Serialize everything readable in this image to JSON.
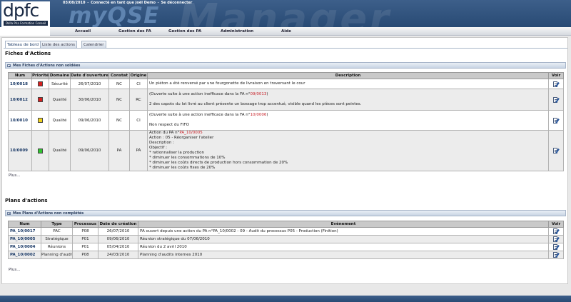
{
  "header": {
    "logo_text": "dpfc",
    "logo_sub": "Dalla Pria Formation Conseil",
    "app_name": "myQSE",
    "watermark": "Manager",
    "date": "03/08/2010",
    "connected": "Connecté en tant que Joël Demo",
    "logout": "Se déconnecter",
    "separator": "-"
  },
  "menu": [
    "Accueil",
    "Gestion des FA",
    "Gestion des PA",
    "Administration",
    "Aide"
  ],
  "tabs": [
    "Tableau de bord",
    "Liste des actions",
    "Calendrier"
  ],
  "fiches": {
    "section_title": "Fiches d'Actions",
    "panel_title": "Mes Fiches d'Actions non soldées",
    "columns": [
      "Num",
      "Priorité",
      "Domaine",
      "Date d'ouverture",
      "Constat",
      "Origine",
      "Description",
      "Voir"
    ],
    "rows": [
      {
        "num": "10/0018",
        "priority_color": "#d6201f",
        "domaine": "Sécurité",
        "date": "26/07/2010",
        "constat": "NC",
        "origine": "CI",
        "desc": [
          {
            "text": "Un piéton a été renversé par une fourgonette de livraison en traversant le cour",
            "red": ""
          }
        ]
      },
      {
        "num": "10/0012",
        "priority_color": "#d6201f",
        "domaine": "Qualité",
        "date": "30/06/2010",
        "constat": "NC",
        "origine": "RC",
        "desc": [
          {
            "text": "(Ouverte suite à une action inefficace dans la FA n°",
            "red": "09/0013",
            "after": ")"
          },
          {
            "text": ""
          },
          {
            "text": "2 des capots du lot livré au client présente un bossage trop accentué, visible quand les pièces sont peintes.",
            "red": ""
          }
        ]
      },
      {
        "num": "10/0010",
        "priority_color": "#f0d21c",
        "domaine": "Qualité",
        "date": "09/06/2010",
        "constat": "NC",
        "origine": "CI",
        "desc": [
          {
            "text": "(Ouverte suite à une action inefficace dans la FA n°",
            "red": "10/0006",
            "after": ")"
          },
          {
            "text": ""
          },
          {
            "text": "Non respect du FIFO",
            "red": ""
          }
        ]
      },
      {
        "num": "10/0009",
        "priority_color": "#2fc42f",
        "domaine": "Qualité",
        "date": "09/06/2010",
        "constat": "PA",
        "origine": "PA",
        "desc": [
          {
            "text": "Action du PA n°",
            "red": "PA_10/0005",
            "after": ""
          },
          {
            "text": "Action : 05 - Réorganiser l'atelier",
            "red": ""
          },
          {
            "text": "Description :",
            "red": ""
          },
          {
            "text": "Objectif :",
            "red": ""
          },
          {
            "text": "* rationnaliser la production",
            "red": ""
          },
          {
            "text": "* diminuer les consommations de 10%",
            "red": ""
          },
          {
            "text": "* diminuer les coûts directs de production hors consommation de 20%",
            "red": ""
          },
          {
            "text": "* diminuer les coûts fixes de 20%",
            "red": ""
          }
        ]
      }
    ],
    "more": "Plus..."
  },
  "plans": {
    "section_title": "Plans d'actions",
    "panel_title": "Mes Plans d'Actions non complétés",
    "columns": [
      "Num",
      "Type",
      "Processus",
      "Date de création",
      "Evènement",
      "Voir"
    ],
    "rows": [
      {
        "num": "PA_10/0017",
        "type": "PAC",
        "processus": "P08",
        "date": "26/07/2010",
        "evenement": "PA ouvert depuis une action du PA n°PA_10/0002 - 09 - Audit du processus P05 - Production (Finition)"
      },
      {
        "num": "PA_10/0005",
        "type": "Stratégique",
        "processus": "P01",
        "date": "09/06/2010",
        "evenement": "Réunion stratégique du 07/06/2010"
      },
      {
        "num": "PA_10/0004",
        "type": "Réunions",
        "processus": "P01",
        "date": "05/04/2010",
        "evenement": "Réunion du 2 avril 2010"
      },
      {
        "num": "PA_10/0002",
        "type": "Planning d'audit",
        "processus": "P08",
        "date": "24/03/2010",
        "evenement": "Planning d'audits internes 2010"
      }
    ],
    "more": "Plus..."
  }
}
